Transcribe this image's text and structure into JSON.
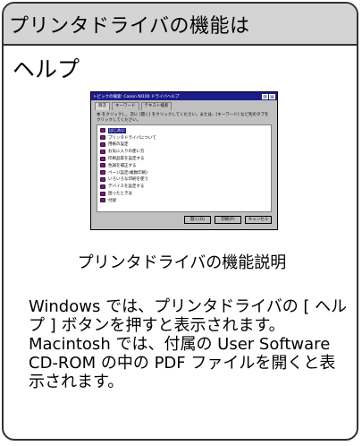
{
  "header": {
    "title": "プリンタドライバの機能は"
  },
  "subtitle": "ヘルプ",
  "dialog": {
    "title": "トピックの検索: Canon NI100 ドライバヘルプ",
    "title_buttons": [
      "?",
      "×"
    ],
    "tabs": [
      "目次",
      "キーワード",
      "テキスト検索"
    ],
    "instruction": "本 をクリックし、次に [開く] をクリックしてください。または、[キーワード] など別のタブをクリックしてください。",
    "items": [
      "はじめに",
      "プリンタドライバについて",
      "用紙の設定",
      "お気に入りの使い方",
      "印刷品質を設定する",
      "色調を補正する",
      "ページ設定(複数印刷)",
      "いろいろな印刷を使う",
      "デバイスを設定する",
      "困ったときは",
      "付録"
    ],
    "selected_index": 0,
    "buttons": [
      "開く(O)",
      "印刷(P)",
      "キャンセル"
    ]
  },
  "caption": "プリンタドライバの機能説明",
  "body": {
    "p1": "Windows では、プリンタドライバの [ ヘルプ ] ボタンを押すと表示されます。",
    "p2": "Macintosh では、付属の User Software CD-ROM の中の PDF ファイルを開くと表示されます。"
  }
}
